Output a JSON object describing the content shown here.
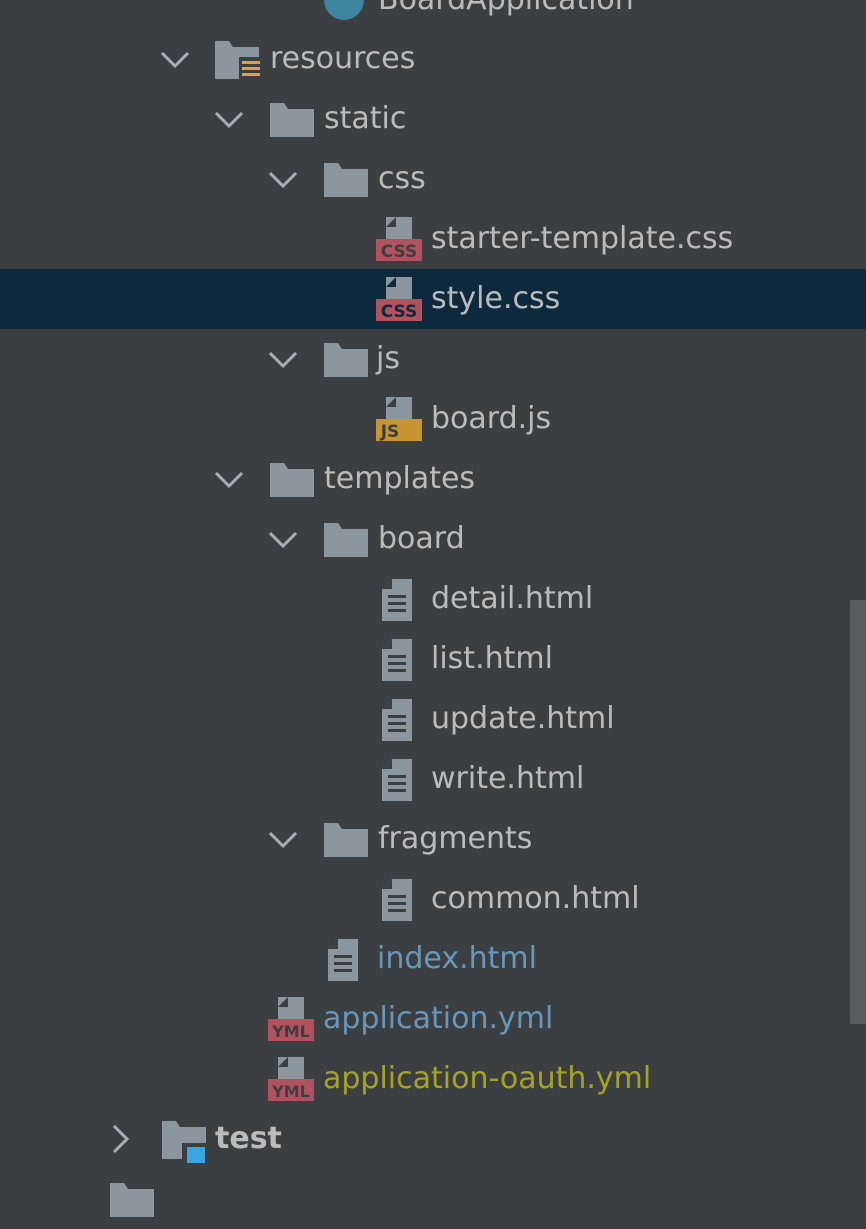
{
  "tree": {
    "top_partial_label": "BoardApplication",
    "items": [
      {
        "label": "resources",
        "icon": "resources-folder-icon",
        "expanded": true
      },
      {
        "label": "static",
        "icon": "folder-icon",
        "expanded": true
      },
      {
        "label": "css",
        "icon": "folder-icon",
        "expanded": true
      },
      {
        "label": "starter-template.css",
        "icon": "css-file-icon",
        "badge": "CSS"
      },
      {
        "label": "style.css",
        "icon": "css-file-icon",
        "badge": "CSS",
        "selected": true
      },
      {
        "label": "js",
        "icon": "folder-icon",
        "expanded": true
      },
      {
        "label": "board.js",
        "icon": "js-file-icon",
        "badge": "JS"
      },
      {
        "label": "templates",
        "icon": "folder-icon",
        "expanded": true
      },
      {
        "label": "board",
        "icon": "folder-icon",
        "expanded": true
      },
      {
        "label": "detail.html",
        "icon": "html-file-icon"
      },
      {
        "label": "list.html",
        "icon": "html-file-icon"
      },
      {
        "label": "update.html",
        "icon": "html-file-icon"
      },
      {
        "label": "write.html",
        "icon": "html-file-icon"
      },
      {
        "label": "fragments",
        "icon": "folder-icon",
        "expanded": true
      },
      {
        "label": "common.html",
        "icon": "html-file-icon"
      },
      {
        "label": "index.html",
        "icon": "html-file-icon",
        "status": "modified"
      },
      {
        "label": "application.yml",
        "icon": "yml-file-icon",
        "badge": "YML",
        "status": "modified"
      },
      {
        "label": "application-oauth.yml",
        "icon": "yml-file-icon",
        "badge": "YML",
        "status": "unversioned"
      },
      {
        "label": "test",
        "icon": "test-folder-icon",
        "expanded": false
      }
    ]
  },
  "colors": {
    "background": "#3c3f41",
    "selection": "#0d293e",
    "text": "#bbbbbb",
    "modified": "#6897bb",
    "unversioned": "#a5a323",
    "folder": "#8c969e",
    "css_badge": "#b3525f",
    "js_badge": "#c99532",
    "yml_badge": "#b3525f",
    "test_marker": "#3ba7e0"
  }
}
